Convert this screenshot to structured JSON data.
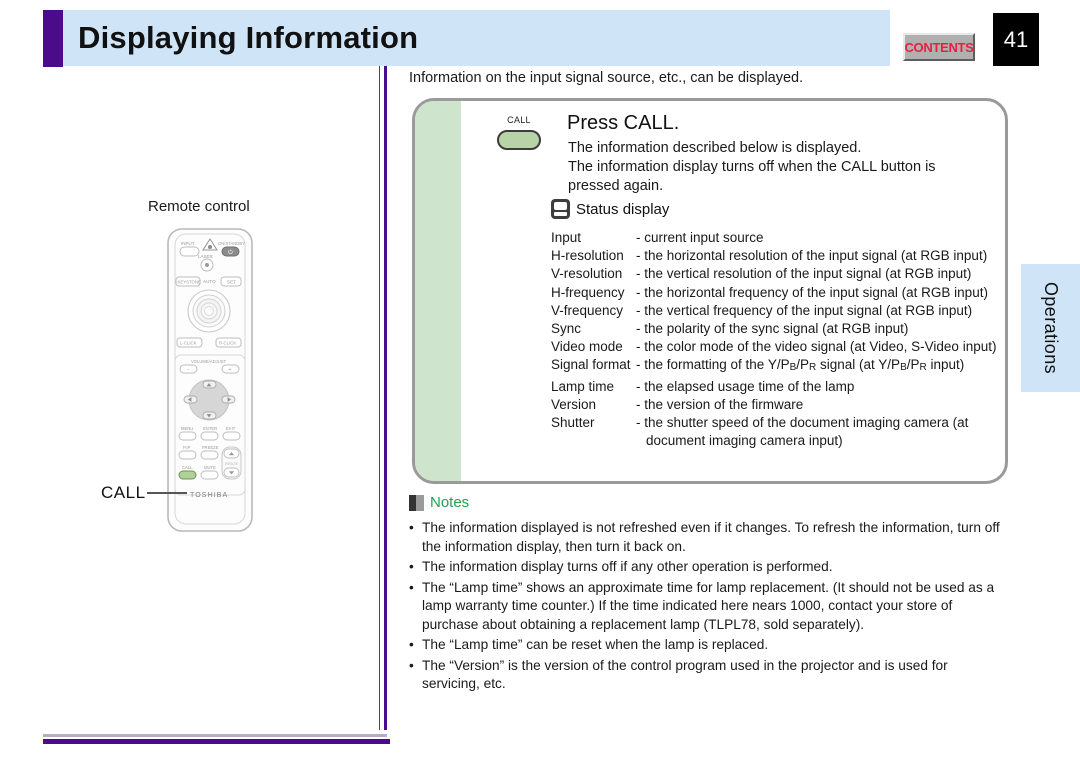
{
  "header": {
    "title": "Displaying Information",
    "contents_label": "CONTENTS",
    "page_number": "41"
  },
  "side_tab": {
    "label": "Operations"
  },
  "left": {
    "remote_caption": "Remote control",
    "call_callout": "CALL",
    "remote_brand": "TOSHIBA",
    "remote_buttons": [
      "INPUT",
      "ON/STANDBY",
      "LASER",
      "KEYSTONE",
      "AUTO",
      "SET",
      "L-CLICK",
      "R-CLICK",
      "VOLUME/ADJUST",
      "MENU",
      "ENTER",
      "EXIT",
      "P.IP",
      "FREEZE",
      "CALL",
      "MUTE",
      "RESIZE"
    ]
  },
  "main": {
    "intro": "Information on the input signal source, etc., can be displayed.",
    "step": {
      "key_label": "CALL",
      "heading": "Press CALL.",
      "lines": [
        "The information described below is displayed.",
        "The information display turns off when the CALL button is",
        "pressed again."
      ]
    },
    "status_display": {
      "label": "Status display",
      "rows": [
        {
          "term": "Input",
          "desc": "- current input source"
        },
        {
          "term": "H-resolution",
          "desc": "- the horizontal resolution of the input signal (at RGB input)"
        },
        {
          "term": "V-resolution",
          "desc": "- the vertical resolution of the input signal (at RGB input)"
        },
        {
          "term": "H-frequency",
          "desc": "- the horizontal frequency of the input signal (at RGB input)"
        },
        {
          "term": "V-frequency",
          "desc": "- the vertical frequency of the input signal (at RGB input)"
        },
        {
          "term": "Sync",
          "desc": "- the polarity of the sync signal (at RGB input)"
        },
        {
          "term": "Video mode",
          "desc": "- the color mode of the video signal (at Video, S-Video input)"
        },
        {
          "term": "Signal format",
          "desc": "- the formatting of the Y/PB/PR signal (at Y/PB/PR input)",
          "subscripts": true
        },
        {
          "term": "Lamp time",
          "desc": "- the elapsed usage time of the lamp"
        },
        {
          "term": "Version",
          "desc": "- the version of the firmware"
        },
        {
          "term": "Shutter",
          "desc": "- the shutter speed of the document imaging camera (at",
          "cont": "document imaging camera input)"
        }
      ]
    }
  },
  "notes": {
    "title": "Notes",
    "bullet": "•",
    "items": [
      "The information displayed is not refreshed even if it changes. To refresh the information, turn off the information display, then turn it back on.",
      "The information display turns off if any other operation is performed.",
      "The “Lamp time” shows an approximate time for lamp replacement. (It should not be used as a lamp warranty time counter.) If the time indicated here nears 1000, contact your store of purchase about obtaining a replacement lamp (TLPL78, sold separately).",
      "The “Lamp time” can be reset when the lamp is replaced.",
      "The “Version” is the version of the control program used in the projector and is used for servicing, etc."
    ]
  },
  "colors": {
    "accent_purple": "#4b0b8c",
    "header_blue": "#cfe4f7",
    "panel_green": "#cfe4cc",
    "notes_green": "#22a24f",
    "contents_red": "#e8213f"
  }
}
